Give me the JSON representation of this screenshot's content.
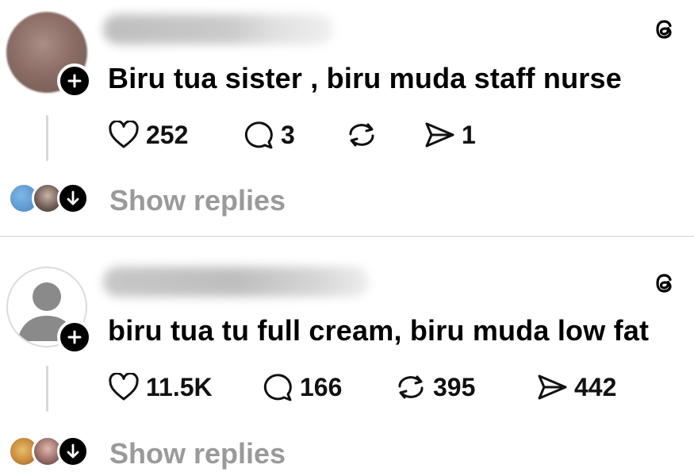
{
  "posts": [
    {
      "reply_text": "Biru tua sister , biru muda staff nurse",
      "likes": "252",
      "comments": "3",
      "reposts": "",
      "shares": "1",
      "show_replies": "Show replies"
    },
    {
      "reply_text": "biru tua tu full cream, biru muda low fat",
      "likes": "11.5K",
      "comments": "166",
      "reposts": "395",
      "shares": "442",
      "show_replies": "Show replies"
    }
  ],
  "icons": {
    "like": "heart-icon",
    "comment": "comment-bubble-icon",
    "repost": "repost-icon",
    "share": "send-icon",
    "brand": "threads-logo-icon"
  }
}
